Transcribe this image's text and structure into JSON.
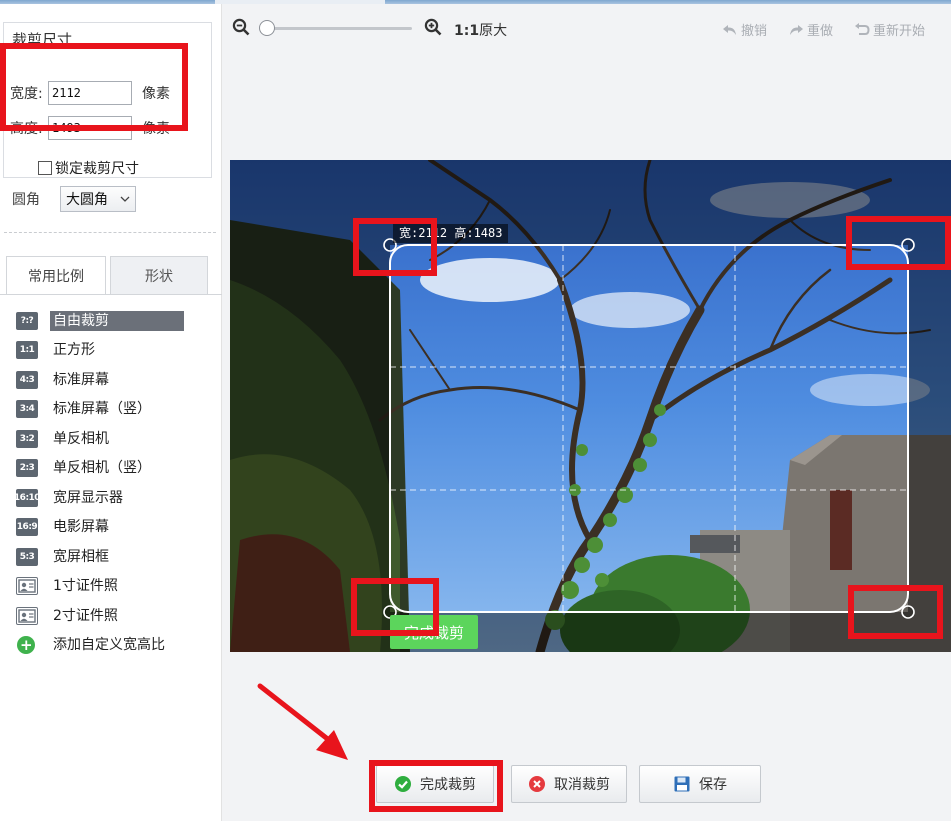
{
  "left_panel": {
    "crop_size": {
      "title": "裁剪尺寸",
      "width_label": "宽度:",
      "width_value": "2112",
      "height_label": "高度:",
      "height_value": "1493",
      "unit": "像素",
      "lock_label": "锁定裁剪尺寸",
      "lock_checked": false
    },
    "corner": {
      "label": "圆角",
      "selected": "大圆角"
    },
    "tabs": [
      {
        "label": "常用比例",
        "active": true
      },
      {
        "label": "形状",
        "active": false
      }
    ],
    "ratios": [
      {
        "icon": "?:?",
        "label": "自由裁剪",
        "active": true
      },
      {
        "icon": "1:1",
        "label": "正方形"
      },
      {
        "icon": "4:3",
        "label": "标准屏幕"
      },
      {
        "icon": "3:4",
        "label": "标准屏幕（竖）"
      },
      {
        "icon": "3:2",
        "label": "单反相机"
      },
      {
        "icon": "2:3",
        "label": "单反相机（竖）"
      },
      {
        "icon": "16:10",
        "label": "宽屏显示器"
      },
      {
        "icon": "16:9",
        "label": "电影屏幕"
      },
      {
        "icon": "5:3",
        "label": "宽屏相框"
      },
      {
        "icon": "id-photo-icon",
        "label": "1寸证件照"
      },
      {
        "icon": "id-photo-icon",
        "label": "2寸证件照"
      },
      {
        "icon": "plus-icon",
        "label": "添加自定义宽高比"
      }
    ]
  },
  "toolbar": {
    "zoom_ratio": "1:1",
    "original_size": "原大",
    "undo": "撤销",
    "redo": "重做",
    "restart": "重新开始",
    "zoom_level": 0
  },
  "canvas": {
    "size_tip": "宽:2112 高:1483",
    "crop_chip": "完成裁剪"
  },
  "buttons": {
    "done": "完成裁剪",
    "cancel": "取消裁剪",
    "save": "保存"
  },
  "colors": {
    "accent_green": "#5cd55c",
    "annotation_red": "#e8141c",
    "active_item": "#6b7079"
  }
}
